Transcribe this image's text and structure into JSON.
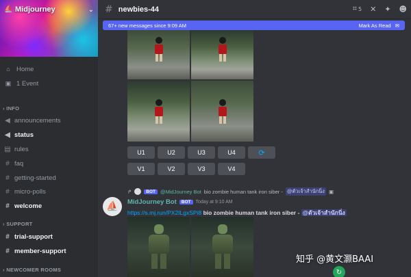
{
  "server": {
    "name": "Midjourney"
  },
  "sidebar": {
    "top_items": [
      {
        "icon": "home-icon",
        "label": "Home"
      },
      {
        "icon": "calendar-icon",
        "label": "1 Event"
      }
    ],
    "sections": [
      {
        "label": "INFO",
        "channels": [
          {
            "label": "announcements",
            "bright": false
          },
          {
            "label": "status",
            "bright": true
          },
          {
            "label": "rules",
            "bright": false
          },
          {
            "label": "faq",
            "bright": false
          },
          {
            "label": "getting-started",
            "bright": false
          },
          {
            "label": "micro-polls",
            "bright": false
          },
          {
            "label": "welcome",
            "bright": true
          }
        ]
      },
      {
        "label": "SUPPORT",
        "channels": [
          {
            "label": "trial-support",
            "bright": true
          },
          {
            "label": "member-support",
            "bright": true
          }
        ]
      },
      {
        "label": "NEWCOMER ROOMS",
        "channels": []
      }
    ]
  },
  "header": {
    "channel": "newbies-44",
    "thread_count": "5"
  },
  "new_messages": {
    "text": "67+ new messages since 9:09 AM",
    "action": "Mark As Read"
  },
  "buttons": {
    "upscale": [
      "U1",
      "U2",
      "U3",
      "U4"
    ],
    "variation": [
      "V1",
      "V2",
      "V3",
      "V4"
    ]
  },
  "reply": {
    "author": "@MidJourney Bot",
    "bot_tag": "BOT",
    "prompt": "bio zombie human tank iron siber - ",
    "mention": "@ตัวเจ้าสำนักนิ่ง"
  },
  "message": {
    "author": "MidJourney Bot",
    "bot_tag": "BOT",
    "time": "Today at 9:10 AM",
    "link": "https://s.mj.run/PX2ILgxSPi8",
    "prompt": " bio zombie human tank iron siber - ",
    "mention": "@ตัวเจ้าสำนักนิ่ง"
  },
  "watermark": "知乎 @黄文灏BAAI"
}
